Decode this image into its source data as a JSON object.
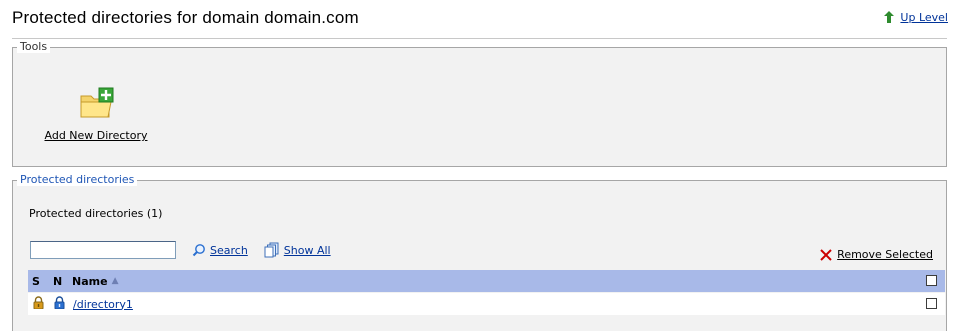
{
  "page": {
    "title": "Protected directories for domain domain.com",
    "up_level_label": "Up Level"
  },
  "tools": {
    "legend": "Tools",
    "add_new_directory_label": "Add New Directory"
  },
  "protected": {
    "legend": "Protected directories",
    "count_label": "Protected directories (1)",
    "search_value": "",
    "search_label": "Search",
    "show_all_label": "Show All",
    "remove_selected_label": "Remove Selected"
  },
  "table": {
    "headers": {
      "s": "S",
      "n": "N",
      "name": "Name",
      "sort_indicator": "▲"
    },
    "rows": [
      {
        "name": "/directory1",
        "selected": false
      }
    ]
  },
  "colors": {
    "header_bg": "#a8b9e8",
    "link": "#003399",
    "up_arrow": "#2e8b2e",
    "remove_x": "#cc0000",
    "lock_orange": "#d99a1a",
    "lock_blue": "#2a6fd0"
  },
  "icons": {
    "up_level": "up-arrow-icon",
    "add_directory": "folder-add-icon",
    "search": "magnifier-icon",
    "show_all": "pages-icon",
    "remove": "red-x-icon",
    "ssl": "lock-icon",
    "non_ssl": "lock-icon"
  }
}
